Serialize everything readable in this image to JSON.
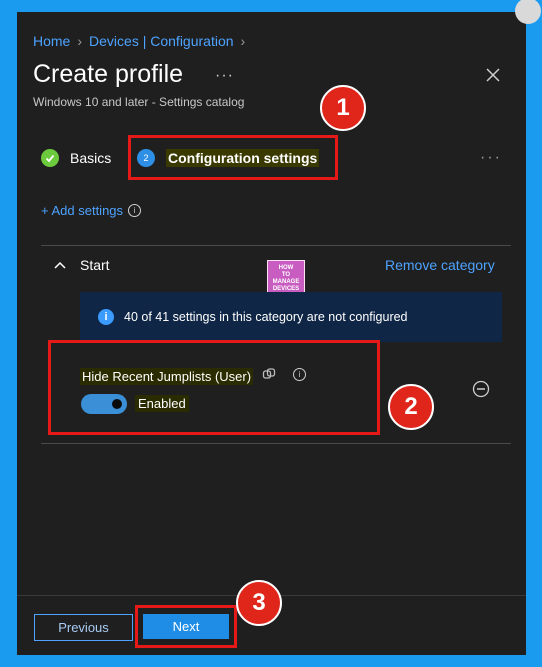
{
  "breadcrumb": {
    "home": "Home",
    "devices": "Devices | Configuration"
  },
  "header": {
    "title": "Create profile",
    "more": "···",
    "subtitle": "Windows 10 and later - Settings catalog"
  },
  "wizard": {
    "steps": [
      {
        "label": "Basics",
        "state": "complete",
        "icon": "check-icon"
      },
      {
        "label": "Configuration settings",
        "state": "active",
        "number": "2"
      }
    ],
    "more": "···"
  },
  "add_settings": {
    "label": "+ Add settings"
  },
  "category": {
    "title": "Start",
    "remove_label": "Remove category",
    "info_text": "40 of 41 settings in this category are not configured",
    "info_icon": "i"
  },
  "watermark": {
    "lines": [
      "HOW",
      "TO",
      "MANAGE",
      "DEVICES"
    ]
  },
  "setting": {
    "name": "Hide Recent Jumplists (User)",
    "toggle_label": "Enabled",
    "toggle_on": true
  },
  "footer": {
    "previous": "Previous",
    "next": "Next"
  },
  "callouts": [
    "1",
    "2",
    "3"
  ],
  "colors": {
    "accent": "#4da3ff",
    "highlight": "#e61919",
    "background": "#1b9bf0",
    "panel": "#1f1f1f"
  }
}
